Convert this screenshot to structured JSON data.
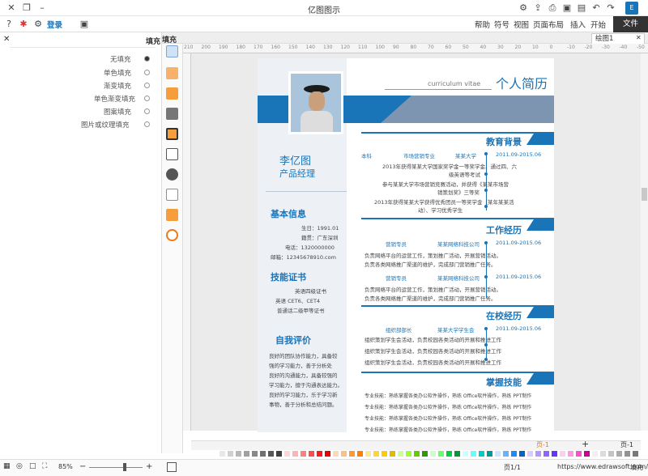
{
  "window": {
    "title": "亿图图示"
  },
  "menu": {
    "file": "文件",
    "items": [
      "开始",
      "插入",
      "页面布局",
      "视图",
      "符号",
      "帮助"
    ],
    "login": "登录"
  },
  "doc_tab": {
    "label": "绘图1"
  },
  "panel": {
    "title": "填充",
    "options": [
      "无填充",
      "单色填充",
      "渐变填充",
      "单色渐变填充",
      "图案填充",
      "图片或纹理填充"
    ]
  },
  "ruler": {
    "ticks": [
      "-50",
      "-40",
      "-30",
      "-20",
      "-10",
      "0",
      "10",
      "20",
      "30",
      "40",
      "50",
      "60",
      "70",
      "80",
      "90",
      "100",
      "110",
      "120",
      "130",
      "140",
      "150",
      "160",
      "170",
      "180",
      "190",
      "200",
      "210"
    ]
  },
  "resume": {
    "title": "个人简历",
    "subtitle": "curriculum vitae",
    "name": "李亿图",
    "role": "产品经理",
    "basic_title": "基本信息",
    "basic": [
      "生日：1991.01",
      "籍贯：广东深圳",
      "电话：1320000000",
      "邮箱：12345678910.com"
    ],
    "skills_title": "技能证书",
    "skills": [
      "英语四级证书",
      "英语 CET6、CET4",
      "普通话二级甲等证书"
    ],
    "eval_title": "自我评价",
    "eval": [
      "良好的团队协作能力，具备较",
      "强的学习能力，善于分析处",
      "良好的沟通能力，具备较强的",
      "学习能力，擅于沟通表达能力。",
      "良好的学习能力，乐于学习新",
      "事物，善于分析和总结问题。"
    ],
    "edu_title": "教育背景",
    "edu_head": {
      "date": "2011.09-2015.06",
      "school": "某某大学",
      "major": "市场营销专业",
      "degree": "本科"
    },
    "edu_lines": [
      "2013年获得某某大学国家奖学金一等奖学金、通过四、六",
      "级英语等考试",
      "参与某某大学市场营销竞赛活动，并获得《某某市场营",
      "销策划奖》三等奖",
      "2013年获得某某大学获得优秀团员一等奖学金（某年某某活",
      "动）、学习优秀学生"
    ],
    "work_title": "工作经历",
    "work": [
      {
        "date": "2011.09-2015.06",
        "company": "某某网络科技公司",
        "position": "营销专员",
        "lines": [
          "负责网络平台的运营工作，策划推广活动，开展营销活动。",
          "负责各类网络推广渠道的维护，完成部门营销推广任务。"
        ]
      },
      {
        "date": "2011.09-2015.06",
        "company": "某某网络科技公司",
        "position": "营销专员",
        "lines": [
          "负责网络平台的运营工作，策划推广活动，开展营销活动。",
          "负责各类网络推广渠道的维护，完成部门营销推广任务。"
        ]
      }
    ],
    "campus_title": "在校经历",
    "campus_head": {
      "date": "2011.09-2015.06",
      "org": "某某大学学生会",
      "position": "组织部部长"
    },
    "campus_lines": [
      "组织策划学生会活动，负责校园各类活动的开展和推进工作",
      "组织策划学生会活动，负责校园各类活动的开展和推进工作",
      "组织策划学生会活动，负责校园各类活动的开展和推进工作"
    ],
    "master_title": "掌握技能",
    "master_lines": [
      "专业技能：熟练掌握各类办公软件操作，熟练 Office软件操作，熟练 PPT制作",
      "专业技能：熟练掌握各类办公软件操作，熟练 Office软件操作，熟练 PPT制作",
      "专业技能：熟练掌握各类办公软件操作，熟练 Office软件操作，熟练 PPT制作",
      "专业技能：熟练掌握各类办公软件操作，熟练 Office软件操作，熟练 PPT制作"
    ]
  },
  "page_tabs": {
    "page": "页-1",
    "add": "+",
    "current": "页-1"
  },
  "status": {
    "url": "https://www.edrawsoft.com/cn/",
    "page_info": "页1/1",
    "zoom": "85%",
    "fill_label": "填充"
  },
  "colors": {
    "accent": "#1a74b8",
    "file_bg": "#333333"
  }
}
